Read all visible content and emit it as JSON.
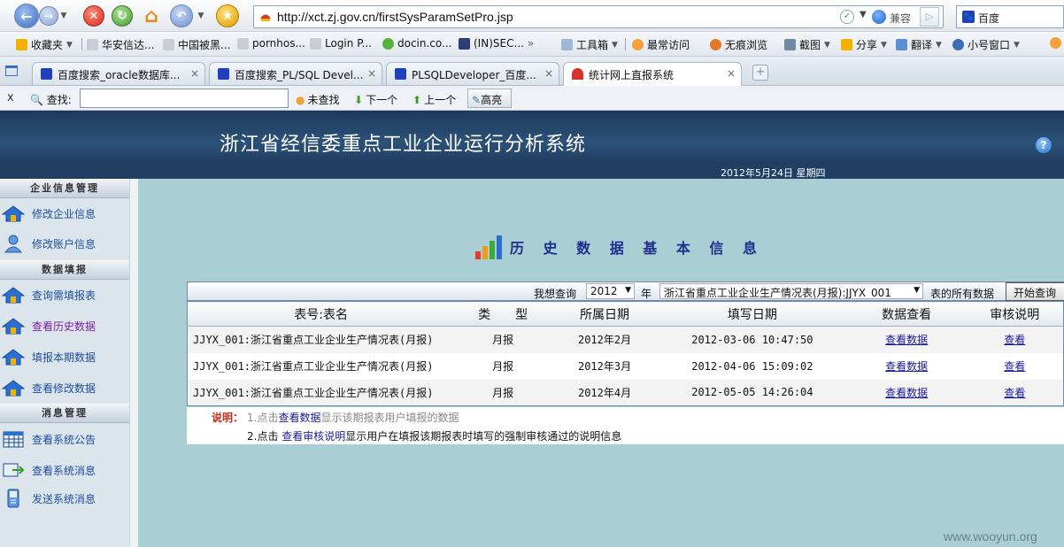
{
  "browser": {
    "address": "http://xct.zj.gov.cn/firstSysParamSetPro.jsp",
    "compat_label": "兼容",
    "search_engine": "百度",
    "favorites": [
      {
        "label": "收藏夹",
        "color": "#f2b300"
      },
      {
        "label": "华安信达...",
        "color": "#888888"
      },
      {
        "label": "中国被黑...",
        "color": "#888888"
      },
      {
        "label": "pornhos...",
        "color": "#888888"
      },
      {
        "label": "Login P...",
        "color": "#888888"
      },
      {
        "label": "docin.co...",
        "color": "#58b23f"
      },
      {
        "label": "(IN)SEC...",
        "color": "#2c3e78"
      }
    ],
    "tools": [
      {
        "label": "工具箱"
      },
      {
        "label": "最常访问"
      },
      {
        "label": "无痕浏览"
      },
      {
        "label": "截图"
      },
      {
        "label": "分享"
      },
      {
        "label": "翻译"
      },
      {
        "label": "小号窗口"
      }
    ],
    "tabs": [
      {
        "label": "百度搜索_oracle数据库...",
        "close": "×",
        "color": "#1f3fbf"
      },
      {
        "label": "百度搜索_PL/SQL Devel...",
        "close": "×",
        "color": "#1f3fbf"
      },
      {
        "label": "PLSQLDeveloper_百度...",
        "close": "×",
        "color": "#1f3fbf"
      },
      {
        "label": "统计网上直报系统",
        "close": "×",
        "color": "#d8332a"
      }
    ],
    "find": {
      "close": "x",
      "label": "查找:",
      "value": "",
      "not_found": "未查找",
      "next": "下一个",
      "prev": "上一个",
      "highlight": "高亮"
    }
  },
  "page": {
    "system_title": "浙江省经信委重点工业企业运行分析系统",
    "date": "2012年5月24日  星期四",
    "heading": "历 史 数 据 基 本 信 息",
    "help": "?",
    "sidebar": {
      "sections": [
        {
          "title": "企业信息管理",
          "items": [
            {
              "label": "修改企业信息",
              "icon": "house-icon",
              "current": false
            },
            {
              "label": "修改账户信息",
              "icon": "user-icon",
              "current": false
            }
          ]
        },
        {
          "title": "数据填报",
          "items": [
            {
              "label": "查询需填报表",
              "icon": "house-icon",
              "current": false
            },
            {
              "label": "查看历史数据",
              "icon": "house-icon",
              "current": true
            },
            {
              "label": "填报本期数据",
              "icon": "house-icon",
              "current": false
            },
            {
              "label": "查看修改数据",
              "icon": "house-icon",
              "current": false
            }
          ]
        },
        {
          "title": "消息管理",
          "items": [
            {
              "label": "查看系统公告",
              "icon": "calendar-icon",
              "current": false
            },
            {
              "label": "查看系统消息",
              "icon": "message-icon",
              "current": false
            },
            {
              "label": "发送系统消息",
              "icon": "phone-icon",
              "current": false
            }
          ]
        }
      ]
    },
    "query": {
      "prefix": "我想查询",
      "year": "2012",
      "year_suffix": "年",
      "report": "浙江省重点工业企业生产情况表(月报):JJYX_001",
      "suffix": "表的所有数据",
      "button": "开始查询"
    },
    "table": {
      "headers": [
        "表号:表名",
        "类　　型",
        "所属日期",
        "填写日期",
        "数据查看",
        "审核说明"
      ],
      "rows": [
        {
          "name": "JJYX_001:浙江省重点工业企业生产情况表(月报)",
          "type": "月报",
          "period": "2012年2月",
          "filled": "2012-03-06 10:47:50",
          "view": "查看数据",
          "review": "查看"
        },
        {
          "name": "JJYX_001:浙江省重点工业企业生产情况表(月报)",
          "type": "月报",
          "period": "2012年3月",
          "filled": "2012-04-06 15:09:02",
          "view": "查看数据",
          "review": "查看"
        },
        {
          "name": "JJYX_001:浙江省重点工业企业生产情况表(月报)",
          "type": "月报",
          "period": "2012年4月",
          "filled": "2012-05-05 14:26:04",
          "view": "查看数据",
          "review": "查看"
        }
      ]
    },
    "notes": {
      "label": "说明：",
      "n1_pre": "1.点击",
      "n1_kw": "查看数据",
      "n1_post": "显示该期报表用户填报的数据",
      "n2_pre": "2.点击 ",
      "n2_kw": "查看审核说明",
      "n2_post": "显示用户在填报该期报表时填写的强制审核通过的说明信息"
    }
  },
  "watermark": "www.wooyun.org",
  "colors": {
    "header": "#2c5178",
    "main_bg": "#a9cfd5",
    "link": "#1a1a9c",
    "current_link": "#7b1fa2"
  }
}
